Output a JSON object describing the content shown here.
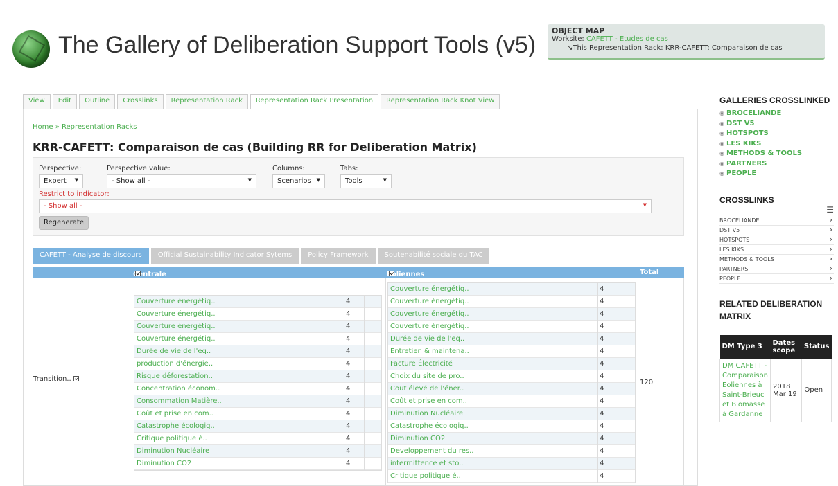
{
  "site": {
    "title": "The Gallery of Deliberation Support Tools (v5)"
  },
  "object_map": {
    "title": "OBJECT MAP",
    "worksite_label": "Worksite: ",
    "worksite_value": "CAFETT - Etudes de cas",
    "arrow": "↘",
    "rack_link": "This Representation Rack",
    "rack_value": ": KRR-CAFETT: Comparaison de cas"
  },
  "tabs": [
    "View",
    "Edit",
    "Outline",
    "Crosslinks",
    "Representation Rack",
    "Representation Rack Presentation",
    "Representation Rack Knot View"
  ],
  "breadcrumb": "Home » Representation Racks",
  "page_title": "KRR-CAFETT: Comparaison de cas (Building RR for Deliberation Matrix)",
  "filters": {
    "perspective_label": "Perspective:",
    "perspective_value": "Expert",
    "pvalue_label": "Perspective value:",
    "pvalue_value": "- Show all -",
    "columns_label": "Columns:",
    "columns_value": "Scenarios",
    "tabs_label": "Tabs:",
    "tabs_value": "Tools",
    "restrict_label": "Restrict to indicator:",
    "restrict_value": "- Show all -",
    "regenerate": "Regenerate"
  },
  "ptabs": [
    "CAFETT - Analyse de discours",
    "Official Sustainability Indicator Sytems",
    "Policy Framework",
    "Soutenabilité sociale du TAC"
  ],
  "matrix": {
    "col1": "Centrale B..",
    "col2": "Eoliennes ..",
    "total_header": "Total",
    "row_label": "Transition..",
    "total": "120",
    "col1_items": [
      {
        "name": "Couverture énergétiq..",
        "value": "4"
      },
      {
        "name": "Couverture énergétiq..",
        "value": "4"
      },
      {
        "name": "Couverture énergétiq..",
        "value": "4"
      },
      {
        "name": "Couverture énergétiq..",
        "value": "4"
      },
      {
        "name": "Durée de vie de l'eq..",
        "value": "4"
      },
      {
        "name": "production d'énergie..",
        "value": "4"
      },
      {
        "name": "Risque déforestation..",
        "value": "4"
      },
      {
        "name": "Concentration économ..",
        "value": "4"
      },
      {
        "name": "Consommation Matière..",
        "value": "4"
      },
      {
        "name": "Coût et prise en com..",
        "value": "4"
      },
      {
        "name": "Catastrophe écologiq..",
        "value": "4"
      },
      {
        "name": "Critique politique é..",
        "value": "4"
      },
      {
        "name": "Diminution Nucléaire",
        "value": "4"
      },
      {
        "name": "Diminution CO2",
        "value": "4"
      }
    ],
    "col2_items": [
      {
        "name": "Couverture énergétiq..",
        "value": "4"
      },
      {
        "name": "Couverture énergétiq..",
        "value": "4"
      },
      {
        "name": "Couverture énergétiq..",
        "value": "4"
      },
      {
        "name": "Couverture énergétiq..",
        "value": "4"
      },
      {
        "name": "Durée de vie de l'eq..",
        "value": "4"
      },
      {
        "name": "Entretien & maintena..",
        "value": "4"
      },
      {
        "name": "Facture Électricité",
        "value": "4"
      },
      {
        "name": "Choix du site de pro..",
        "value": "4"
      },
      {
        "name": "Cout élevé de l'éner..",
        "value": "4"
      },
      {
        "name": "Coût et prise en com..",
        "value": "4"
      },
      {
        "name": "Diminution Nucléaire",
        "value": "4"
      },
      {
        "name": "Catastrophe écologiq..",
        "value": "4"
      },
      {
        "name": "Diminution CO2",
        "value": "4"
      },
      {
        "name": "Developpement du res..",
        "value": "4"
      },
      {
        "name": "intermittence et sto..",
        "value": "4"
      },
      {
        "name": "Critique politique é..",
        "value": "4"
      }
    ]
  },
  "sidebar": {
    "galleries_title": "GALLERIES CROSSLINKED",
    "galleries": [
      "BROCELIANDE",
      "DST V5",
      "HOTSPOTS",
      "LES KIKS",
      "METHODS & TOOLS",
      "PARTNERS",
      "PEOPLE"
    ],
    "crosslinks_title": "CROSSLINKS",
    "crosslinks": [
      "BROCELIANDE",
      "DST V5",
      "HOTSPOTS",
      "LES KIKS",
      "METHODS & TOOLS",
      "PARTNERS",
      "PEOPLE"
    ],
    "related_title": "RELATED DELIBERATION MATRIX",
    "dm_headers": [
      "DM Type 3",
      "Dates scope",
      "Status"
    ],
    "dm_row": {
      "name": "DM CAFETT - Comparaison Eoliennes à Saint-Brieuc et Biomasse à Gardanne",
      "date": "2018 Mar 19",
      "status": "Open"
    }
  },
  "colors": {
    "accent": "#4caf50",
    "tab_blue": "#7ab3e0",
    "restrict_red": "#d32f2f"
  },
  "icons": [
    "logo-icon",
    "checkbox-icon",
    "bullet-icon",
    "list-icon",
    "chevron-right-icon",
    "caret-down-icon"
  ]
}
